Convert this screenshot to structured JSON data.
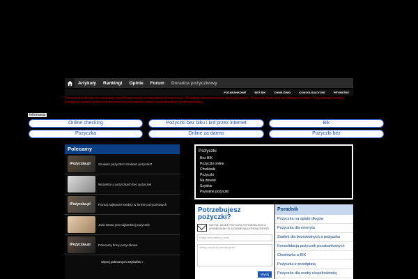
{
  "nav": {
    "items": [
      "Artykuły",
      "Rankingi",
      "Opinie",
      "Forum",
      "Doradca pożyczkowy"
    ]
  },
  "subnav": {
    "items": [
      "POZABANKOWE",
      "BEZ BIK",
      "CHWILÓWKI",
      "KONSOLIDACYJNE",
      "PRYWATNE"
    ]
  },
  "warning": "Firma pożyczkowa nie zastosuje weryfikacji swojej wiarygodności finansowej. Wszelkie zainteresowane będą na datum. Pożyczki dla te bez weryfikacji możliwe. Pożyczkowe kredyty kredyty w ramach pożyczki stosowane pożyczkowe nowe z przedmiotów i podsumowania.",
  "info_label": "Informacja",
  "pills": [
    "Online checking",
    "Pożyczki bez biku i krd przez internet",
    "Bik",
    "Pożyczka",
    "Online za darmo",
    "Pożyczki bez"
  ],
  "polecamy": {
    "title": "Polecamy",
    "items": [
      {
        "thumb": "iPożyczka.pl",
        "text": "Szukasz pożyczki? Szukasz pożyczki?"
      },
      {
        "thumb": "",
        "text": "Wszystko o pożyczkach bez pożyczek"
      },
      {
        "thumb": "iPożyczka.pl",
        "text": "Poznaj najlepsze kredyty w formie pożyczkowych"
      },
      {
        "thumb": "",
        "text": "Jaka kwota jest najbardziej pożyczek"
      },
      {
        "thumb": "iPożyczka.pl",
        "text": "Polecamy firmy pożyczkowe"
      }
    ],
    "more": "więcej polecanych artykułów »"
  },
  "mid_panel": {
    "title": "Pożyczki",
    "lines": [
      "Bez BIK",
      "Pożyczki online",
      "Chwilówki",
      "Pożyczki",
      "Na dowód",
      "Szybkie",
      "Prywatne pożyczki"
    ]
  },
  "form": {
    "title": "Potrzebujesz pożyczki?",
    "desc": "NAPISZ JAKIEJ POŻYCZKI POTRZEBUJESZ A WYBIERZEMY DLA CIEBIE NAJLEPSZĄ OFERTĘ",
    "email_placeholder": "Podaj swój adres e-mail",
    "need_placeholder": "Jakiej pożyczki potrzebujesz?",
    "submit": "Wyślij"
  },
  "poradnik": {
    "title": "Poradnik",
    "items": [
      "Pożyczka na spłatę długów",
      "Pożyczka dla emeryta",
      "Zasiłek dla bezrobotnych a pożyczka",
      "Konsolidacja pożyczek pozabankowych",
      "Chwilówka a BIK",
      "Pożyczka z przedpłatą",
      "Pożyczka dla osoby niepełnoletniej"
    ]
  }
}
